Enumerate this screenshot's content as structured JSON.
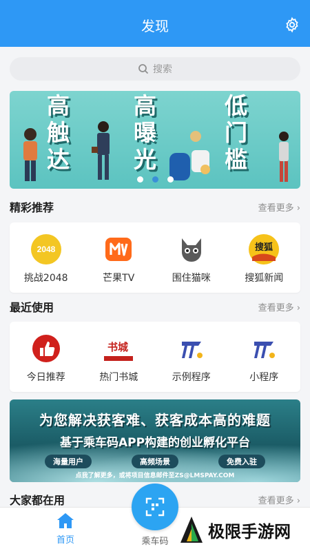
{
  "header": {
    "title": "发现"
  },
  "search": {
    "placeholder": "搜索"
  },
  "banner": {
    "col1": [
      "高",
      "触",
      "达"
    ],
    "col2": [
      "高",
      "曝",
      "光"
    ],
    "col3": [
      "低",
      "门",
      "槛"
    ]
  },
  "featured": {
    "title": "精彩推荐",
    "more": "查看更多",
    "apps": [
      {
        "label": "挑战2048",
        "icon_text": "2048"
      },
      {
        "label": "芒果TV"
      },
      {
        "label": "围住猫咪"
      },
      {
        "label": "搜狐新闻",
        "icon_text": "搜狐"
      }
    ]
  },
  "recent": {
    "title": "最近使用",
    "more": "查看更多",
    "apps": [
      {
        "label": "今日推荐"
      },
      {
        "label": "热门书城",
        "icon_text": "书城"
      },
      {
        "label": "示例程序"
      },
      {
        "label": "小程序"
      }
    ]
  },
  "ad_banner": {
    "line1": "为您解决获客难、获客成本高的难题",
    "line2": "基于乘车码APP构建的创业孵化平台",
    "pills": [
      "海量用户",
      "高频场景",
      "免费入驻"
    ],
    "line4": "点我了解更多，或将项目信息邮件至ZS@LMSPAY.COM"
  },
  "everyone": {
    "title": "大家都在用",
    "more": "查看更多"
  },
  "tabbar": {
    "home": "首页",
    "ride_code": "乘车码"
  },
  "watermark": {
    "text": "极限手游网"
  },
  "colors": {
    "primary": "#2e98f5",
    "banner_bg": "#5cc3c0"
  }
}
